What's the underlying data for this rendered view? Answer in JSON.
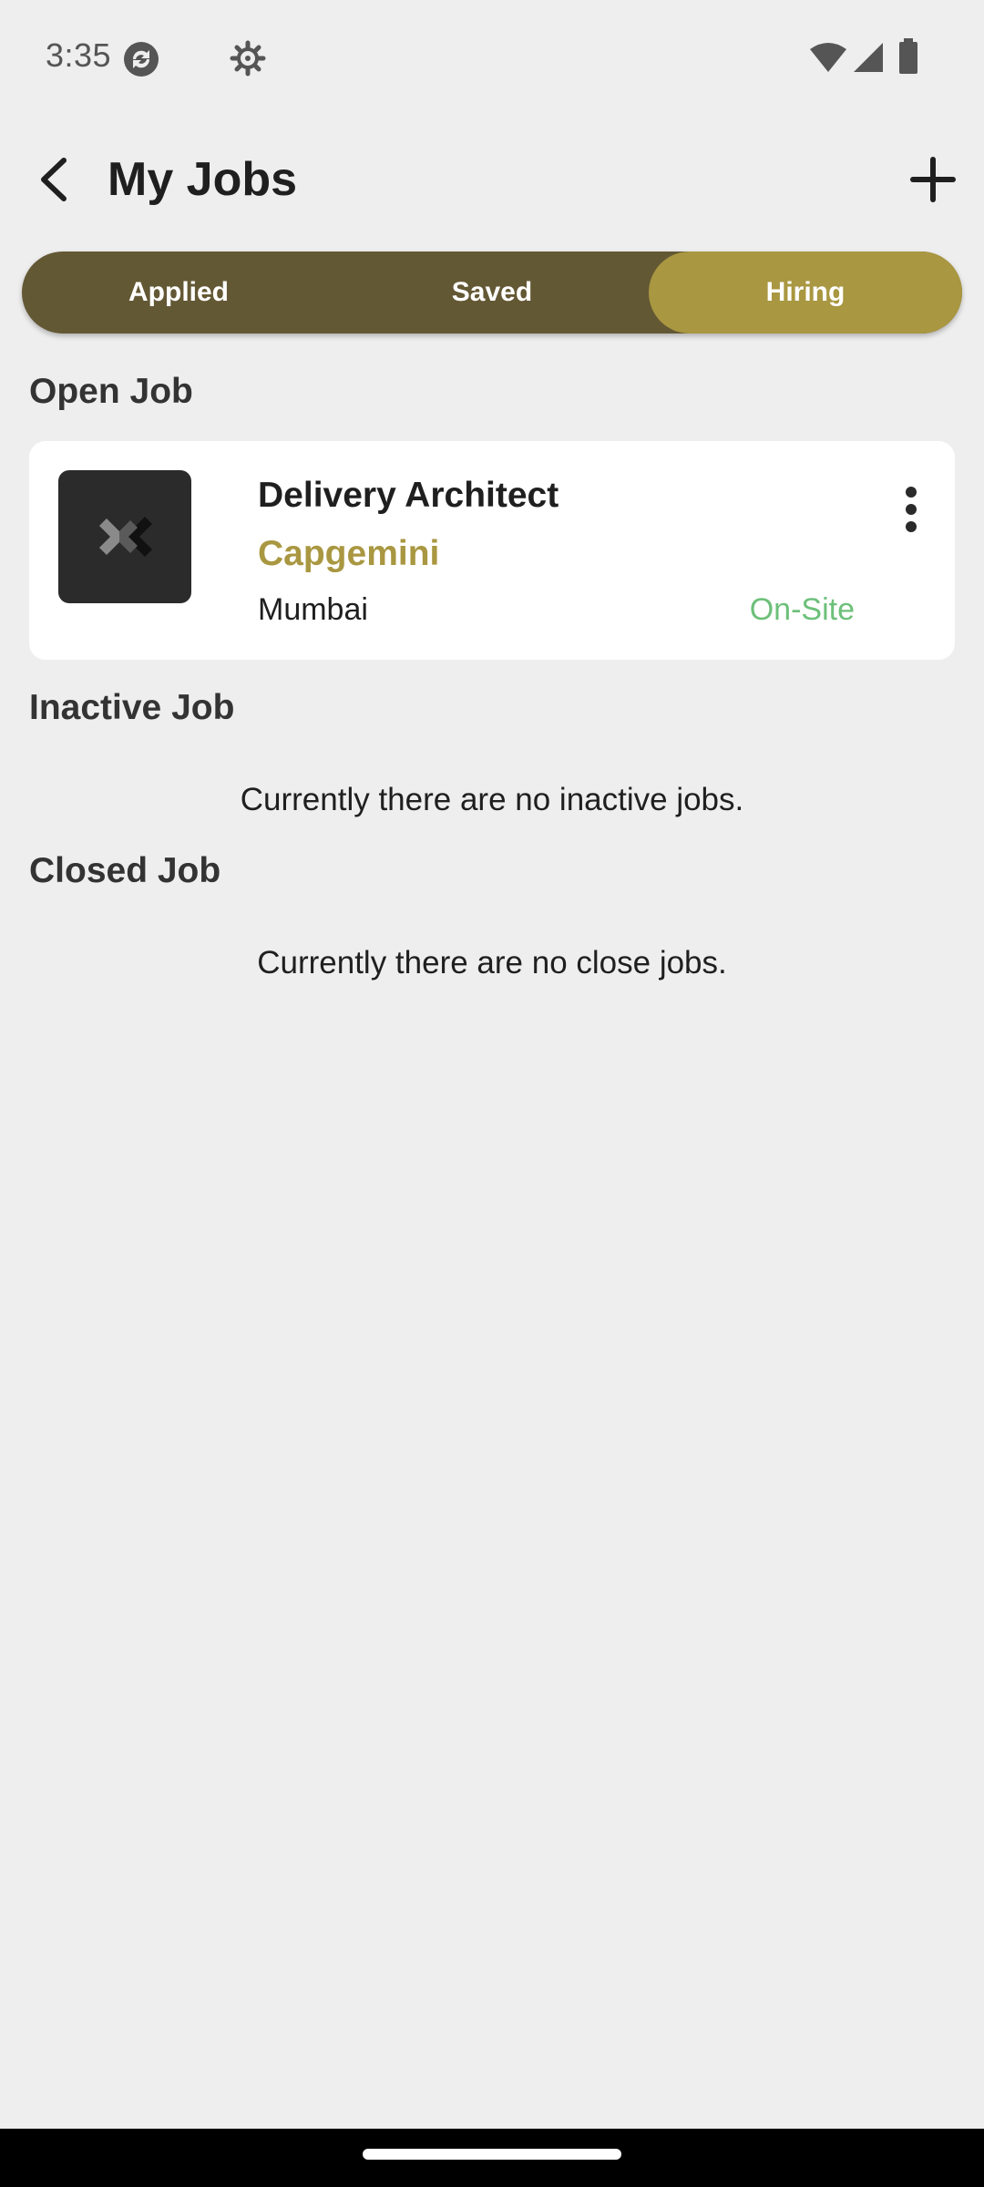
{
  "status_bar": {
    "time": "3:35",
    "icons": [
      "sync-icon",
      "settings-icon",
      "wifi-icon",
      "signal-icon",
      "battery-icon"
    ]
  },
  "app_bar": {
    "title": "My Jobs",
    "back_icon": "back-arrow-icon",
    "add_icon": "plus-icon"
  },
  "tabs": [
    {
      "label": "Applied",
      "active": false
    },
    {
      "label": "Saved",
      "active": false
    },
    {
      "label": "Hiring",
      "active": true
    }
  ],
  "sections": {
    "open": {
      "heading": "Open Job",
      "jobs": [
        {
          "title": "Delivery Architect",
          "company": "Capgemini",
          "location": "Mumbai",
          "work_type": "On-Site"
        }
      ]
    },
    "inactive": {
      "heading": "Inactive Job",
      "empty_message": "Currently there are no inactive jobs."
    },
    "closed": {
      "heading": "Closed Job",
      "empty_message": "Currently there are no close jobs."
    }
  },
  "colors": {
    "background": "#eeeeee",
    "tab_bar": "#635834",
    "tab_active": "#a99741",
    "company": "#a99741",
    "work_type": "#6dc07a"
  }
}
